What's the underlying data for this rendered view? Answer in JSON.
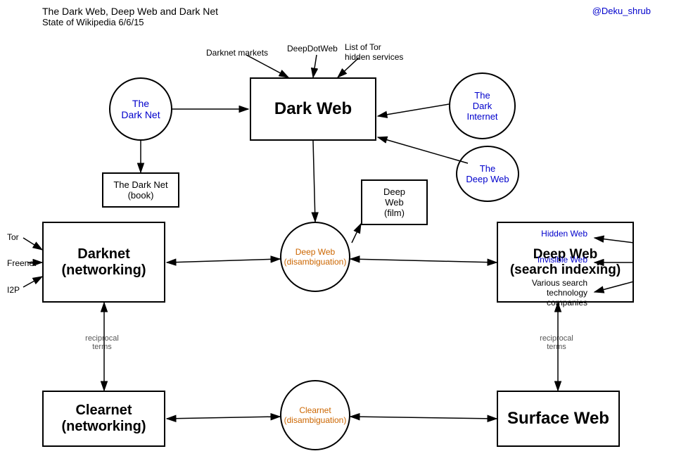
{
  "title": {
    "main": "The Dark Web, Deep Web and Dark Net",
    "sub": "State of Wikipedia 6/6/15",
    "attribution": "@Deku_shrub"
  },
  "nodes": {
    "dark_web": "Dark Web",
    "dark_net_circle": {
      "line1": "The",
      "line2": "Dark Net"
    },
    "dark_internet": {
      "line1": "The",
      "line2": "Dark",
      "line3": "Internet"
    },
    "deep_web_circle": {
      "line1": "The",
      "line2": "Deep Web"
    },
    "dark_net_book": "The Dark Net (book)",
    "deep_web_film": {
      "line1": "Deep",
      "line2": "Web",
      "line3": "(film)"
    },
    "darknet_networking": {
      "line1": "Darknet",
      "line2": "(networking)"
    },
    "deep_web_disambig": {
      "line1": "Deep Web",
      "line2": "(disambiguation)"
    },
    "deep_web_search": {
      "line1": "Deep Web",
      "line2": "(search indexing)"
    },
    "clearnet_networking": {
      "line1": "Clearnet",
      "line2": "(networking)"
    },
    "clearnet_disambig": {
      "line1": "Clearnet",
      "line2": "(disambiguation)"
    },
    "surface_web": "Surface Web"
  },
  "labels": {
    "darknet_markets": "Darknet markets",
    "deepdotweb": "DeepDotWeb",
    "list_tor": "List of Tor hidden services",
    "tor": "Tor",
    "freenet": "Freenet",
    "i2p": "I2P",
    "hidden_web": "Hidden Web",
    "invisible_web": "Invisible Web",
    "various_search": "Various search technology companies",
    "reciprocal_left": "reciprocal\nterms",
    "reciprocal_right": "reciprocal\nterms"
  }
}
